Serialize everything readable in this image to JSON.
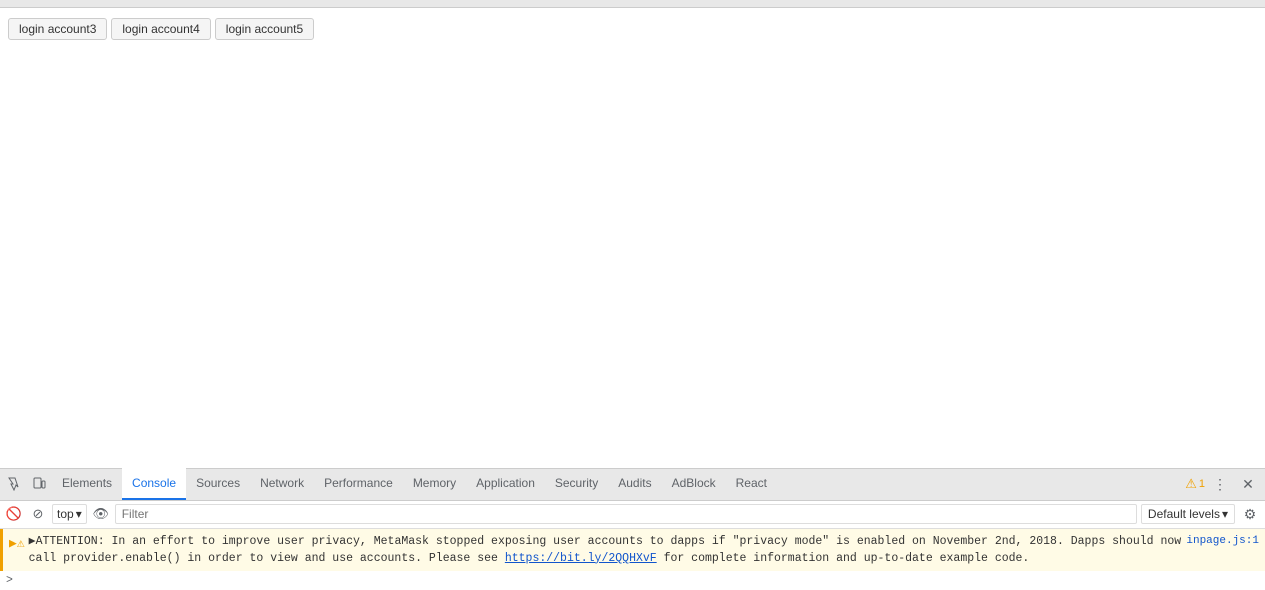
{
  "browser": {
    "top_bar_height": 8
  },
  "page": {
    "login_buttons": [
      {
        "label": "login account3",
        "id": "btn-account3"
      },
      {
        "label": "login account4",
        "id": "btn-account4"
      },
      {
        "label": "login account5",
        "id": "btn-account5"
      }
    ]
  },
  "devtools": {
    "tabs": [
      {
        "label": "Elements",
        "id": "elements",
        "active": false
      },
      {
        "label": "Console",
        "id": "console",
        "active": true
      },
      {
        "label": "Sources",
        "id": "sources",
        "active": false
      },
      {
        "label": "Network",
        "id": "network",
        "active": false
      },
      {
        "label": "Performance",
        "id": "performance",
        "active": false
      },
      {
        "label": "Memory",
        "id": "memory",
        "active": false
      },
      {
        "label": "Application",
        "id": "application",
        "active": false
      },
      {
        "label": "Security",
        "id": "security",
        "active": false
      },
      {
        "label": "Audits",
        "id": "audits",
        "active": false
      },
      {
        "label": "AdBlock",
        "id": "adblock",
        "active": false
      },
      {
        "label": "React",
        "id": "react",
        "active": false
      }
    ],
    "warning_count": "1",
    "console": {
      "context": "top",
      "filter_placeholder": "Filter",
      "default_levels_label": "Default levels",
      "warning_message": "▶ATTENTION: In an effort to improve user privacy, MetaMask stopped exposing user accounts to dapps if \"privacy mode\" is enabled on November 2nd, 2018. Dapps should now call provider.enable() in order to view and use accounts. Please see",
      "warning_link_text": "https://bit.ly/2QQHXvF",
      "warning_message_end": "for complete information and up-to-date example code.",
      "file_ref": "inpage.js:1",
      "prompt_symbol": ">"
    }
  }
}
